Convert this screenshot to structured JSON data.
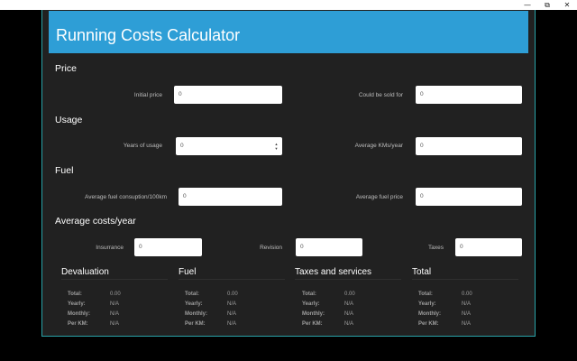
{
  "window": {
    "minimize_glyph": "—",
    "restore_glyph": "⧉",
    "close_glyph": "✕"
  },
  "app": {
    "title": "Running Costs Calculator"
  },
  "price": {
    "heading": "Price",
    "initial_label": "Initial price",
    "initial_value": "0",
    "sold_label": "Could be sold for",
    "sold_value": "0"
  },
  "usage": {
    "heading": "Usage",
    "years_label": "Years of usage",
    "years_value": "0",
    "kms_label": "Average KMs/year",
    "kms_value": "0"
  },
  "fuel": {
    "heading": "Fuel",
    "consumption_label": "Average fuel consuption/100km",
    "consumption_value": "0",
    "price_label": "Average fuel price",
    "price_value": "0"
  },
  "costs": {
    "heading": "Average costs/year",
    "insurance_label": "Insurrance",
    "insurance_value": "0",
    "revision_label": "Revision",
    "revision_value": "0",
    "taxes_label": "Taxes",
    "taxes_value": "0"
  },
  "results": [
    {
      "title": "Devaluation",
      "total_label": "Total:",
      "total": "0.00",
      "yearly_label": "Yearly:",
      "yearly": "N/A",
      "monthly_label": "Monthly:",
      "monthly": "N/A",
      "perkm_label": "Per KM:",
      "perkm": "N/A"
    },
    {
      "title": "Fuel",
      "total_label": "Total:",
      "total": "0.00",
      "yearly_label": "Yearly:",
      "yearly": "N/A",
      "monthly_label": "Monthly:",
      "monthly": "N/A",
      "perkm_label": "Per KM:",
      "perkm": "N/A"
    },
    {
      "title": "Taxes and services",
      "total_label": "Total:",
      "total": "0.00",
      "yearly_label": "Yearly:",
      "yearly": "N/A",
      "monthly_label": "Monthly:",
      "monthly": "N/A",
      "perkm_label": "Per KM:",
      "perkm": "N/A"
    },
    {
      "title": "Total",
      "total_label": "Total:",
      "total": "0.00",
      "yearly_label": "Yearly:",
      "yearly": "N/A",
      "monthly_label": "Monthly:",
      "monthly": "N/A",
      "perkm_label": "Per KM:",
      "perkm": "N/A"
    }
  ]
}
